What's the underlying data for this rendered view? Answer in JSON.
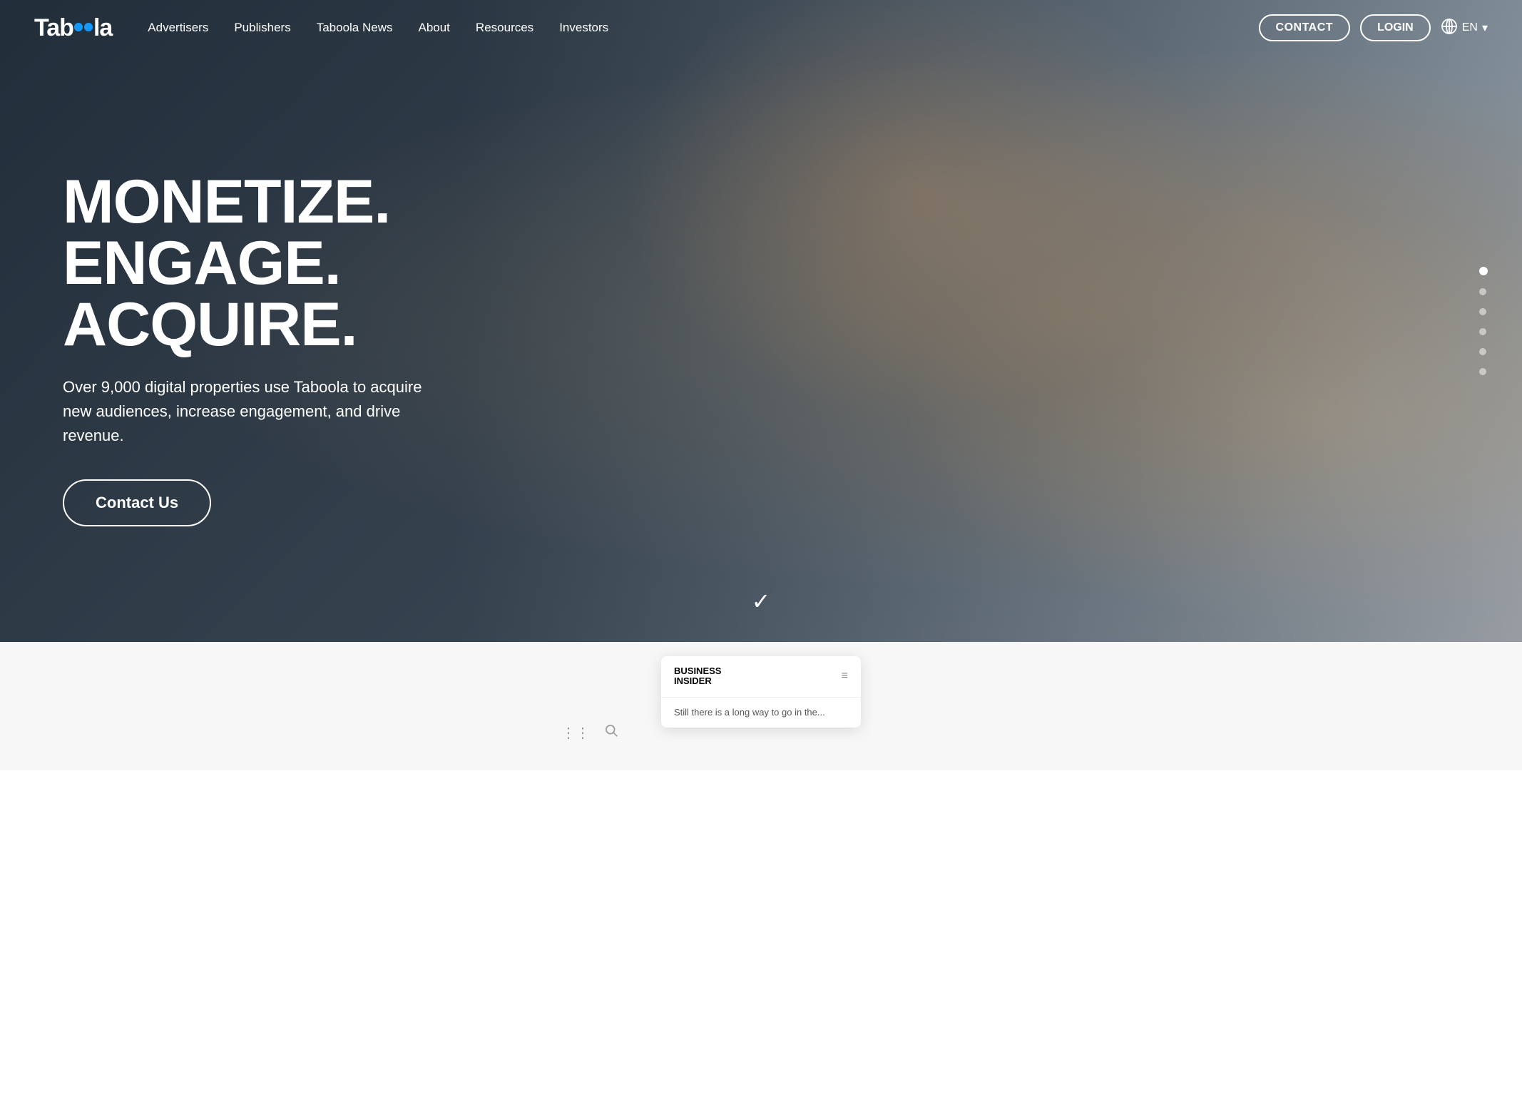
{
  "brand": {
    "name": "Taboola",
    "logo_text_start": "Tab",
    "logo_text_end": "la"
  },
  "nav": {
    "links": [
      {
        "id": "advertisers",
        "label": "Advertisers"
      },
      {
        "id": "publishers",
        "label": "Publishers"
      },
      {
        "id": "taboola-news",
        "label": "Taboola News"
      },
      {
        "id": "about",
        "label": "About"
      },
      {
        "id": "resources",
        "label": "Resources"
      },
      {
        "id": "investors",
        "label": "Investors"
      }
    ],
    "contact_label": "CONTACT",
    "login_label": "LOGIN",
    "language": "EN"
  },
  "hero": {
    "headline_line1": "MONETIZE.",
    "headline_line2": "ENGAGE.",
    "headline_line3": "ACQUIRE.",
    "subtext": "Over 9,000 digital properties use Taboola to acquire new audiences, increase engagement, and drive revenue.",
    "cta_label": "Contact Us"
  },
  "side_dots": {
    "count": 6,
    "active_index": 0
  },
  "business_insider": {
    "logo_line1": "BUSINESS",
    "logo_line2": "INSIDER",
    "body_text": "Still there is a long way to go in the..."
  },
  "icons": {
    "globe": "🌐",
    "chevron_down": "▾",
    "checkmark": "✓",
    "grid": "⋮⋮",
    "search": "🔍",
    "hamburger": "≡"
  }
}
